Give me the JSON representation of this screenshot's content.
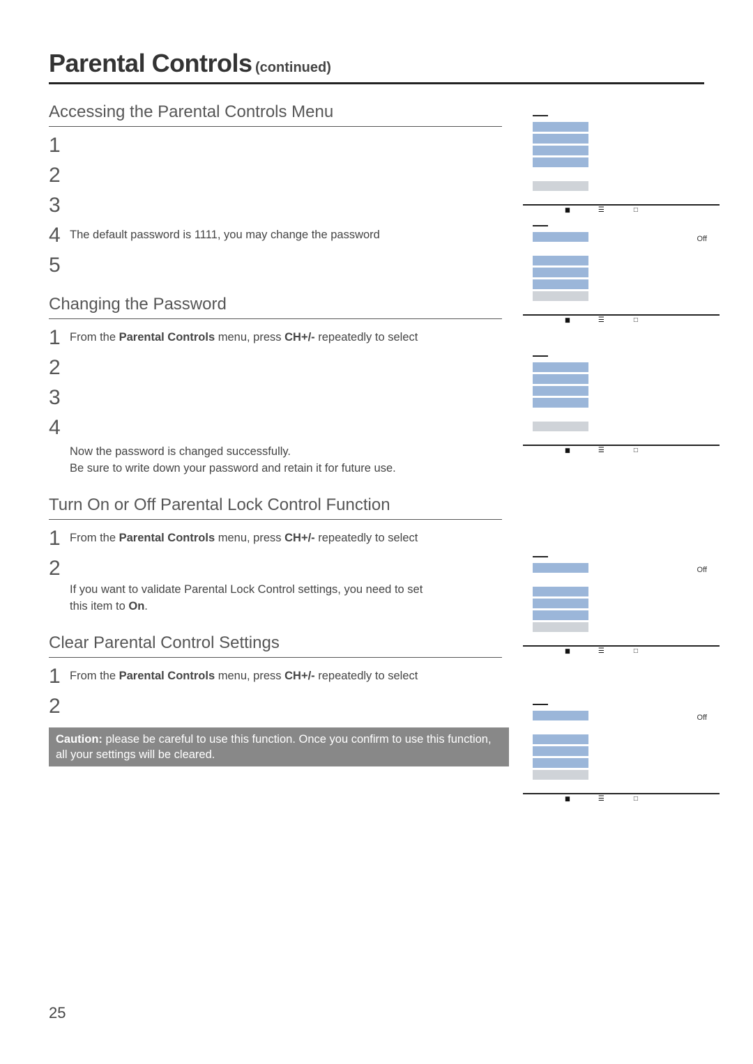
{
  "header": {
    "title": "Parental Controls",
    "continued": "(continued)"
  },
  "section_access": {
    "heading": "Accessing the Parental Controls Menu",
    "steps": [
      "1",
      "2",
      "3",
      "4",
      "5"
    ],
    "step4_text": "The default password is 1111, you may change the password"
  },
  "section_password": {
    "heading": "Changing the Password",
    "step1_prefix": "From the ",
    "step1_bold1": "Parental Controls",
    "step1_mid": " menu, press ",
    "step1_bold2": "CH+/-",
    "step1_suffix": " repeatedly to select",
    "steps_rest": [
      "2",
      "3",
      "4"
    ],
    "after_text_l1": "Now the password is changed successfully.",
    "after_text_l2": "Be sure to write down your password and retain it for future use."
  },
  "section_onoff": {
    "heading": "Turn On or Off Parental Lock Control Function",
    "step1_prefix": "From the ",
    "step1_bold1": "Parental Controls",
    "step1_mid": " menu, press ",
    "step1_bold2": "CH+/-",
    "step1_suffix": " repeatedly to select",
    "step2_l1": "If you want to validate Parental Lock Control settings, you need to set",
    "step2_l2_prefix": "this item to ",
    "step2_l2_bold": "On",
    "step2_l2_suffix": "."
  },
  "section_clear": {
    "heading": "Clear Parental Control Settings",
    "step1_prefix": "From the ",
    "step1_bold1": "Parental Controls",
    "step1_mid": " menu, press ",
    "step1_bold2": "CH+/-",
    "step1_suffix": " repeatedly to select",
    "step2": "2",
    "caution_label": "Caution:",
    "caution_text": " please be careful to use this function. Once you confirm to use this function, all your settings will be cleared."
  },
  "menu_common": {
    "off_label": "Off"
  },
  "page_number": "25"
}
